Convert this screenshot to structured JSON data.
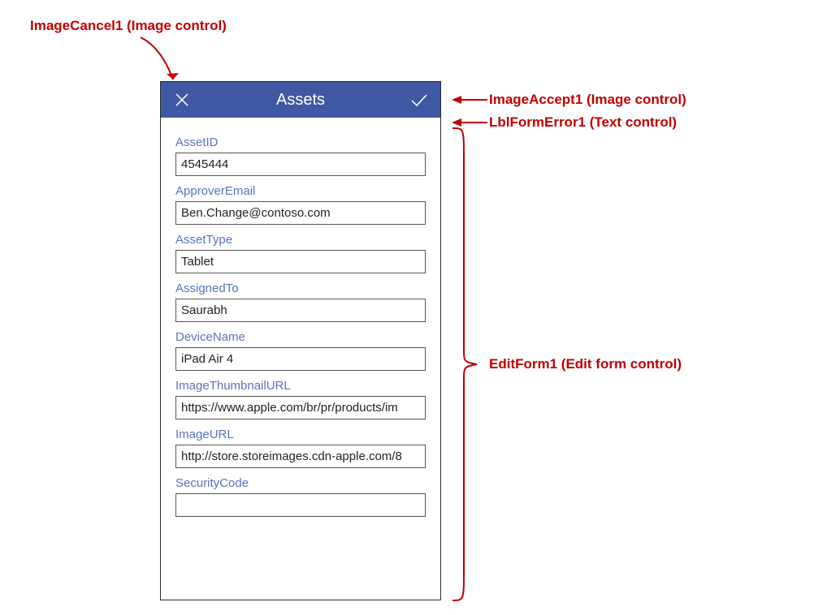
{
  "annotations": {
    "cancel": "ImageCancel1 (Image control)",
    "accept": "ImageAccept1 (Image control)",
    "error": "LblFormError1 (Text control)",
    "form": "EditForm1 (Edit form control)"
  },
  "phone": {
    "title": "Assets"
  },
  "fields": {
    "f0": {
      "label": "AssetID",
      "value": "4545444"
    },
    "f1": {
      "label": "ApproverEmail",
      "value": "Ben.Change@contoso.com"
    },
    "f2": {
      "label": "AssetType",
      "value": "Tablet"
    },
    "f3": {
      "label": "AssignedTo",
      "value": "Saurabh"
    },
    "f4": {
      "label": "DeviceName",
      "value": "iPad Air 4"
    },
    "f5": {
      "label": "ImageThumbnailURL",
      "value": "https://www.apple.com/br/pr/products/im"
    },
    "f6": {
      "label": "ImageURL",
      "value": "http://store.storeimages.cdn-apple.com/8"
    },
    "f7": {
      "label": "SecurityCode",
      "value": ""
    }
  }
}
